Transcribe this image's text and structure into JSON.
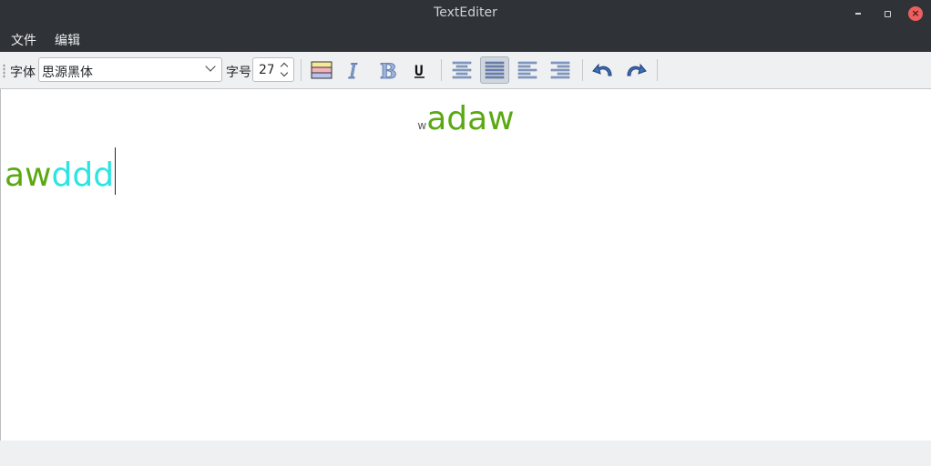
{
  "window": {
    "title": "TextEditer"
  },
  "menu": {
    "items": [
      "文件",
      "编辑"
    ]
  },
  "toolbar": {
    "font_label": "字体",
    "font_value": "思源黑体",
    "size_label": "字号",
    "size_value": "27"
  },
  "editor": {
    "line1": {
      "small": "w",
      "big": "adaw"
    },
    "line2": {
      "part1": "aw",
      "part2": "ddd"
    }
  },
  "colors": {
    "green_text": "#5aa912",
    "cyan_text": "#2be4e4",
    "titlebar": "#2f3338",
    "close": "#ee5e5e"
  }
}
